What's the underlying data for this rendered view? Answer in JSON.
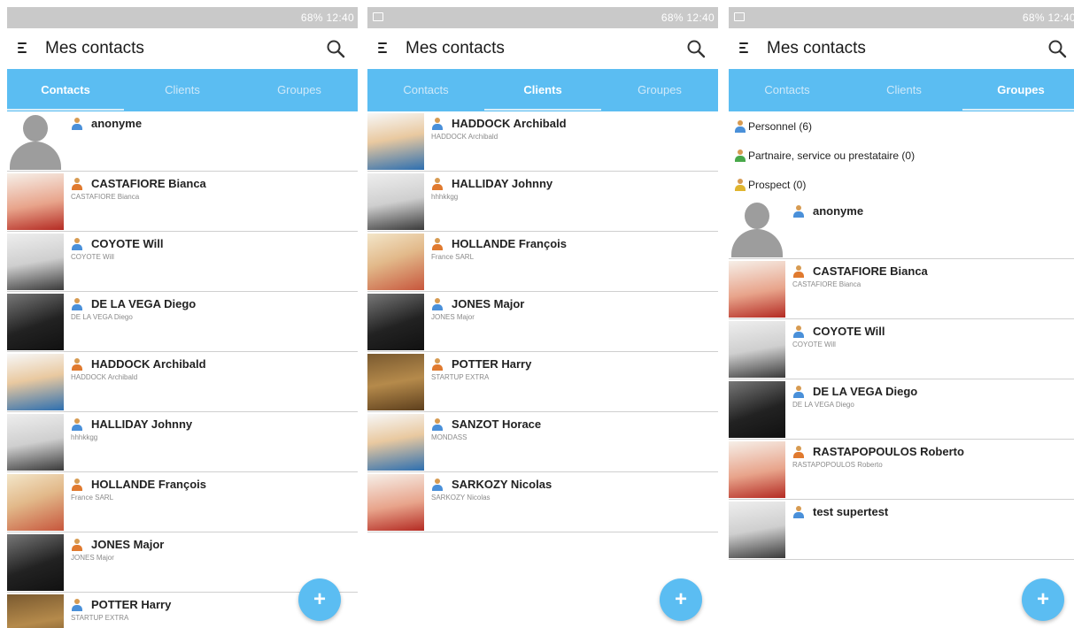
{
  "status_text": "68% 12:40",
  "app_title": "Mes contacts",
  "tabs": [
    "Contacts",
    "Clients",
    "Groupes"
  ],
  "fab_label": "+",
  "screens": [
    {
      "active_tab": 0,
      "contacts": [
        {
          "name": "anonyme",
          "sub": "",
          "avatar": "placeholder"
        },
        {
          "name": "CASTAFIORE Bianca",
          "sub": "CASTAFIORE Bianca",
          "avatar": "red"
        },
        {
          "name": "COYOTE Will",
          "sub": "COYOTE Will",
          "avatar": "grey"
        },
        {
          "name": "DE LA VEGA Diego",
          "sub": "DE LA VEGA Diego",
          "avatar": "dark"
        },
        {
          "name": "HADDOCK Archibald",
          "sub": "HADDOCK Archibald",
          "avatar": "blue"
        },
        {
          "name": "HALLIDAY Johnny",
          "sub": "hhhkkgg",
          "avatar": "grey"
        },
        {
          "name": "HOLLANDE François",
          "sub": "France SARL",
          "avatar": "pic"
        },
        {
          "name": "JONES Major",
          "sub": "JONES Major",
          "avatar": "dark"
        },
        {
          "name": "POTTER Harry",
          "sub": "STARTUP EXTRA",
          "avatar": "brown"
        }
      ]
    },
    {
      "active_tab": 1,
      "contacts": [
        {
          "name": "HADDOCK Archibald",
          "sub": "HADDOCK Archibald",
          "avatar": "blue"
        },
        {
          "name": "HALLIDAY Johnny",
          "sub": "hhhkkgg",
          "avatar": "grey"
        },
        {
          "name": "HOLLANDE François",
          "sub": "France SARL",
          "avatar": "pic"
        },
        {
          "name": "JONES Major",
          "sub": "JONES Major",
          "avatar": "dark"
        },
        {
          "name": "POTTER Harry",
          "sub": "STARTUP EXTRA",
          "avatar": "brown"
        },
        {
          "name": "SANZOT Horace",
          "sub": "MONDASS",
          "avatar": "blue"
        },
        {
          "name": "SARKOZY Nicolas",
          "sub": "SARKOZY Nicolas",
          "avatar": "red"
        }
      ]
    },
    {
      "active_tab": 2,
      "groups": [
        {
          "label": "Personnel (6)",
          "icon": "blue"
        },
        {
          "label": "Partnaire, service ou prestataire (0)",
          "icon": "green"
        },
        {
          "label": "Prospect (0)",
          "icon": "yellow"
        }
      ],
      "contacts": [
        {
          "name": "anonyme",
          "sub": "",
          "avatar": "placeholder"
        },
        {
          "name": "CASTAFIORE Bianca",
          "sub": "CASTAFIORE Bianca",
          "avatar": "red"
        },
        {
          "name": "COYOTE Will",
          "sub": "COYOTE Will",
          "avatar": "grey"
        },
        {
          "name": "DE LA VEGA Diego",
          "sub": "DE LA VEGA Diego",
          "avatar": "dark"
        },
        {
          "name": "RASTAPOPOULOS Roberto",
          "sub": "RASTAPOPOULOS Roberto",
          "avatar": "red"
        },
        {
          "name": "test supertest",
          "sub": "",
          "avatar": "grey"
        }
      ]
    }
  ]
}
